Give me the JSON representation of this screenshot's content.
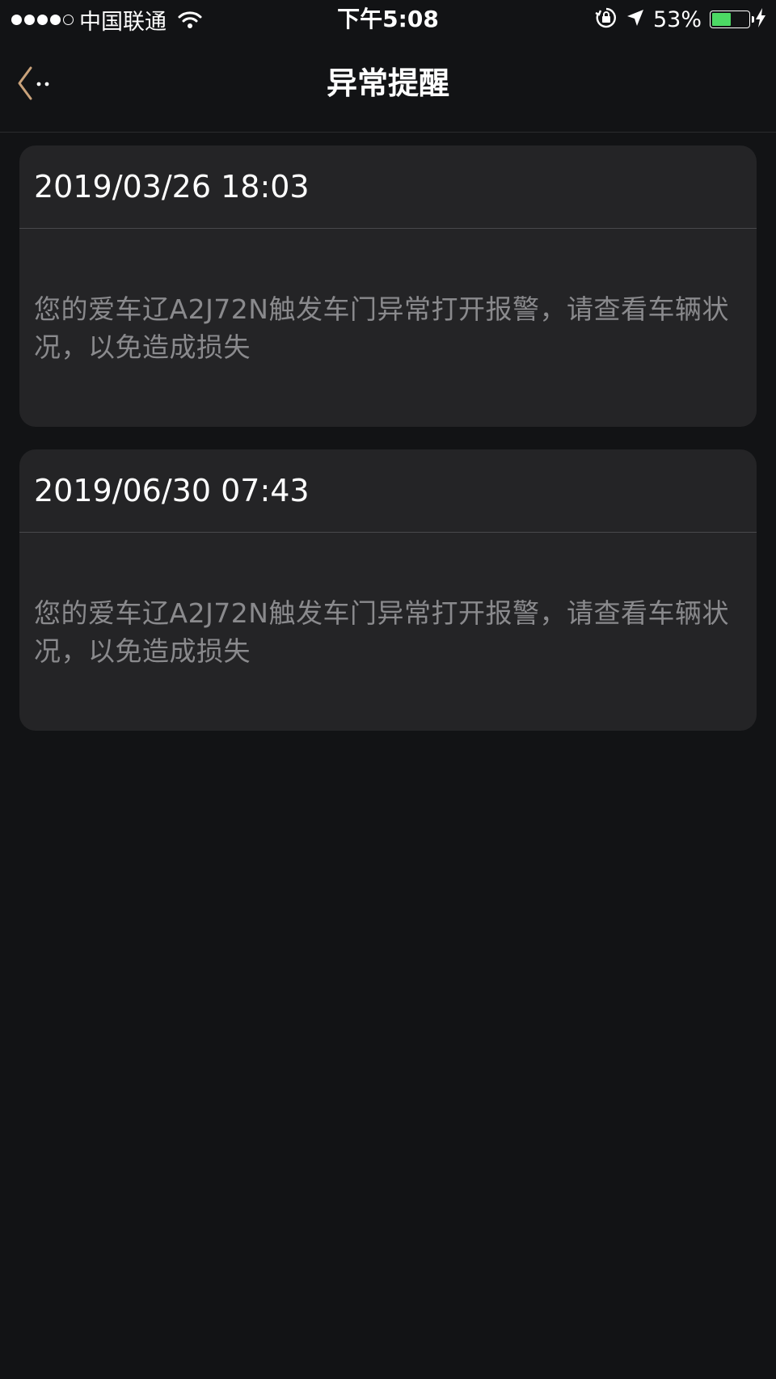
{
  "status_bar": {
    "carrier": "中国联通",
    "time": "下午5:08",
    "battery_percent": "53%",
    "battery_level": 0.53,
    "signal_bars_filled": 4,
    "signal_bars_total": 5,
    "battery_color": "#4cd964"
  },
  "nav": {
    "title": "异常提醒",
    "back_icon": "chevron-left-icon",
    "accent_color": "#c9a27a"
  },
  "alerts": [
    {
      "datetime": "2019/03/26 18:03",
      "message": "您的爱车辽A2J72N触发车门异常打开报警，请查看车辆状况，以免造成损失"
    },
    {
      "datetime": "2019/06/30 07:43",
      "message": "您的爱车辽A2J72N触发车门异常打开报警，请查看车辆状况，以免造成损失"
    }
  ]
}
